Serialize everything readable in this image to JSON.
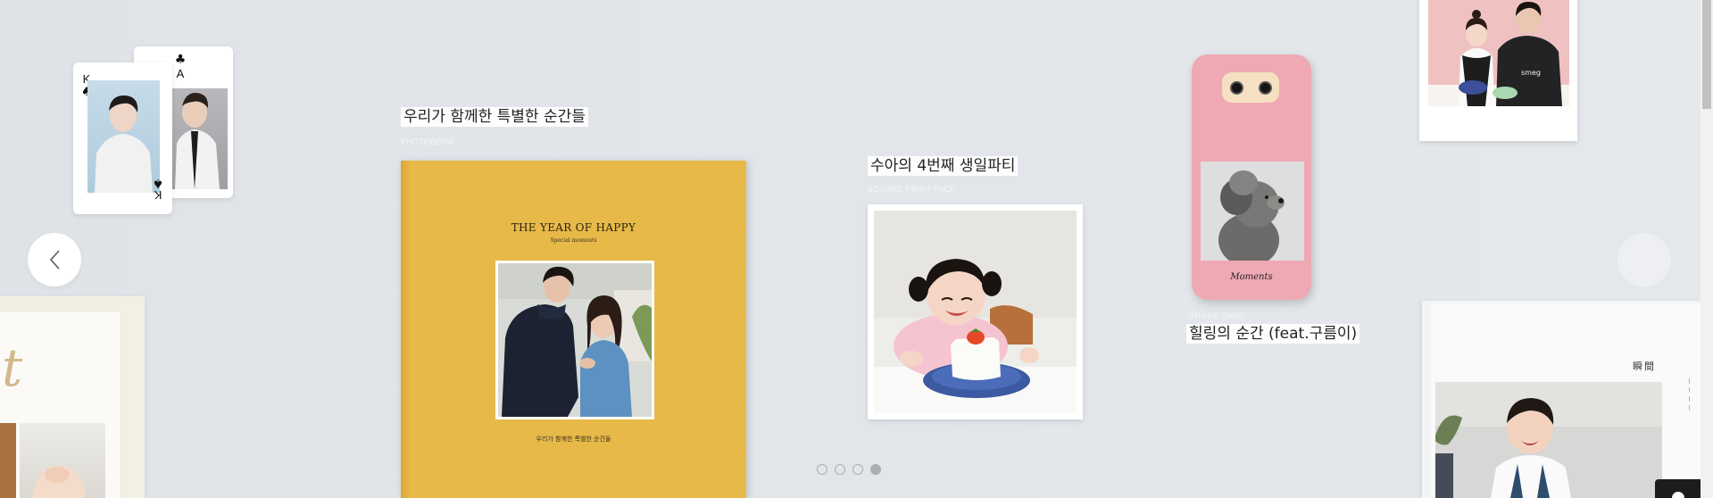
{
  "products": [
    {
      "title": "우리가 함께한 특별한 순간들",
      "category": "PHOTOBOOK"
    },
    {
      "title": "수아의 4번째 생일파티",
      "category": "SQUARE PRINT PACK"
    },
    {
      "title": "힐링의 순간 (feat.구름이)",
      "category": "PHONE CASE"
    }
  ],
  "cards": {
    "back": {
      "rank": "A",
      "suit": "♣"
    },
    "front": {
      "rank": "K",
      "suit": "♠"
    }
  },
  "photobook": {
    "cover_title": "THE YEAR OF HAPPY",
    "cover_subtitle": "Special moments",
    "cover_footer": "우리가 함께한 특별한 순간들"
  },
  "phone_case": {
    "script_text": "Moments"
  },
  "polaroid": {
    "apron_text": "smeg"
  },
  "right_book": {
    "heading": "瞬間"
  },
  "left_book": {
    "script_letter": "t"
  },
  "carousel": {
    "pages": 4,
    "active_index": 3
  },
  "colors": {
    "background": "#e1e5e9",
    "photobook": "#e7b949",
    "phone_case": "#efa9b4"
  },
  "icons": {
    "prev": "chevron-left-icon",
    "next": "chevron-right-icon",
    "chat": "chat-icon"
  }
}
